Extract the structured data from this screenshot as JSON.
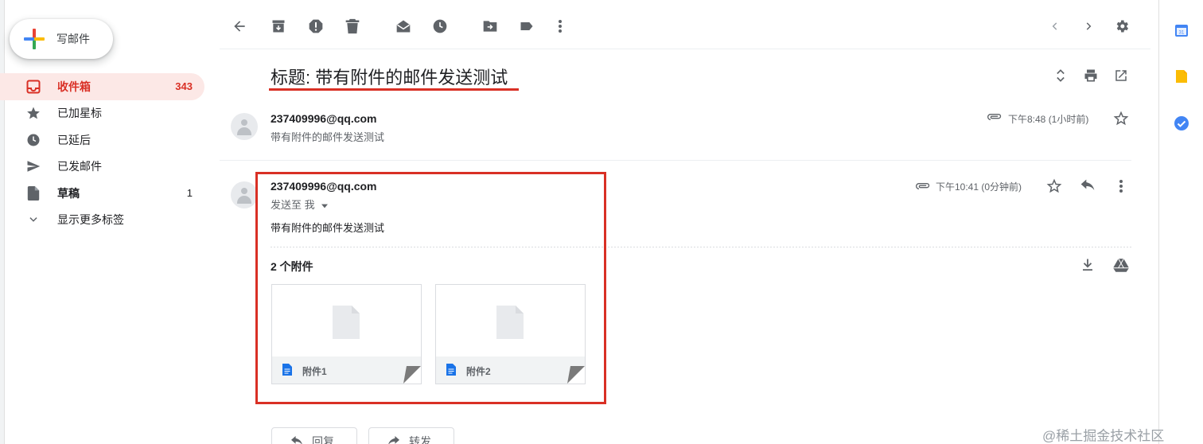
{
  "compose": {
    "label": "写邮件"
  },
  "sidebar": {
    "items": [
      {
        "label": "收件箱",
        "count": "343",
        "icon": "inbox-icon"
      },
      {
        "label": "已加星标",
        "count": "",
        "icon": "star-icon"
      },
      {
        "label": "已延后",
        "count": "",
        "icon": "clock-icon"
      },
      {
        "label": "已发邮件",
        "count": "",
        "icon": "send-icon"
      },
      {
        "label": "草稿",
        "count": "1",
        "icon": "draft-icon"
      },
      {
        "label": "显示更多标签",
        "count": "",
        "icon": "chevron-down-icon"
      }
    ]
  },
  "thread": {
    "subject": "标题: 带有附件的邮件发送测试",
    "messages": [
      {
        "sender": "237409996@qq.com",
        "snippet": "带有附件的邮件发送测试",
        "time": "下午8:48 (1小时前)"
      },
      {
        "sender": "237409996@qq.com",
        "recipient": "发送至 我",
        "body": "带有附件的邮件发送测试",
        "time": "下午10:41 (0分钟前)",
        "attachments_title": "2 个附件",
        "attachments": [
          {
            "name": "附件1"
          },
          {
            "name": "附件2"
          }
        ]
      }
    ],
    "reply_label": "回复",
    "forward_label": "转发"
  },
  "colors": {
    "accent_red": "#d93025",
    "active_bg": "#fce8e6",
    "icon_gray": "#5f6368",
    "doc_blue": "#1a73e8"
  },
  "watermark": "@稀土掘金技术社区"
}
